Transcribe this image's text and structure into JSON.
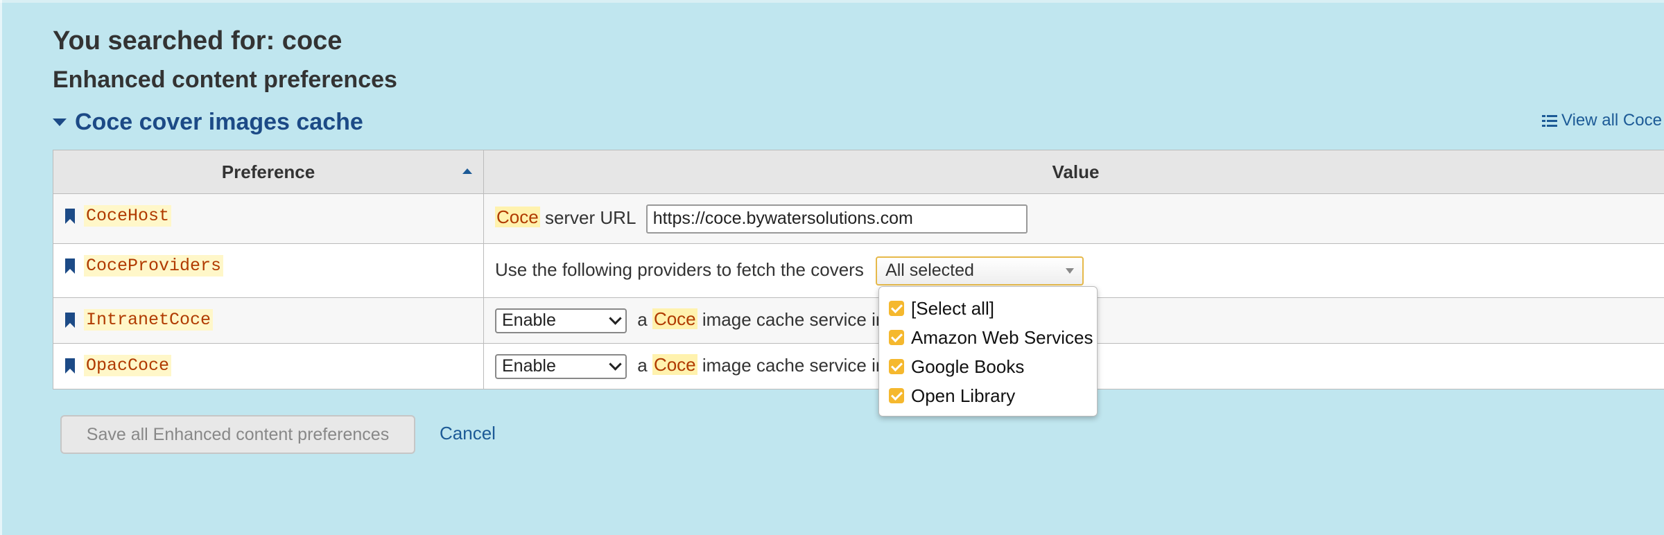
{
  "page": {
    "search_heading": "You searched for: coce",
    "subheading": "Enhanced content preferences",
    "section_title": "Coce cover images cache",
    "view_all_link": "View all Coce"
  },
  "table": {
    "col_preference": "Preference",
    "col_value": "Value",
    "rows": [
      {
        "name": "CoceHost",
        "value_prefix_hl": "Coce",
        "value_text": "server URL",
        "input_value": "https://coce.bywatersolutions.com"
      },
      {
        "name": "CoceProviders",
        "value_text": "Use the following providers to fetch the covers",
        "multiselect_value": "All selected"
      },
      {
        "name": "IntranetCoce",
        "select_value": "Enable",
        "value_pre": "a",
        "value_hl": "Coce",
        "value_post": "image cache service in"
      },
      {
        "name": "OpacCoce",
        "select_value": "Enable",
        "value_pre": "a",
        "value_hl": "Coce",
        "value_post": "image cache service in"
      }
    ]
  },
  "dropdown": {
    "options": [
      {
        "label": "[Select all]",
        "checked": true
      },
      {
        "label": "Amazon Web Services",
        "checked": true
      },
      {
        "label": "Google Books",
        "checked": true
      },
      {
        "label": "Open Library",
        "checked": true
      }
    ]
  },
  "actions": {
    "save_label": "Save all Enhanced content preferences",
    "cancel_label": "Cancel"
  },
  "colors": {
    "background": "#c0e6ef",
    "link": "#1c5a96",
    "highlight": "#fff2ae",
    "checkbox": "#f5b82e"
  }
}
